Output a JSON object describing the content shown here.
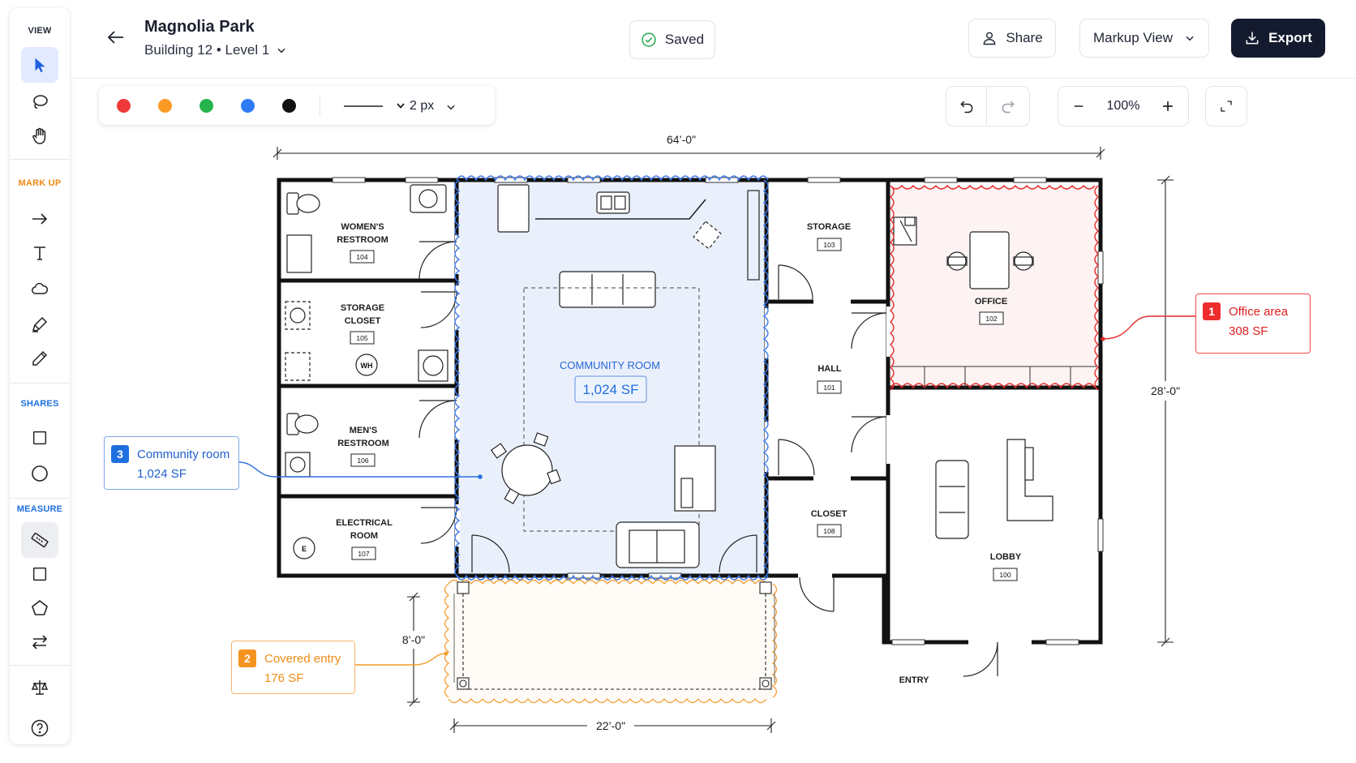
{
  "header": {
    "title": "Magnolia Park",
    "subtitle": "Building 12 • Level 1",
    "saved_label": "Saved",
    "share_label": "Share",
    "view_label": "Markup View",
    "export_label": "Export"
  },
  "rail": {
    "sections": {
      "view": "VIEW",
      "markup": "MARK UP",
      "shares": "SHARES",
      "measure": "MEASURE"
    }
  },
  "toolbar": {
    "colors": [
      "#f03a3a",
      "#fb9a25",
      "#25b44c",
      "#2f7bf5",
      "#111111"
    ],
    "stroke_width": "2 px",
    "zoom": "100%"
  },
  "colors": {
    "accent_blue": "#1f6fe0",
    "accent_red": "#ee2c2c",
    "accent_orange": "#f5931f",
    "dark": "#141b2e"
  },
  "plan": {
    "dimensions": {
      "overall_width": "64’-0\"",
      "overall_depth": "28’-0\"",
      "entry_depth": "8’-0\"",
      "entry_width": "22’-0\""
    },
    "rooms": [
      {
        "name": "WOMEN'S",
        "name2": "RESTROOM",
        "number": "104"
      },
      {
        "name": "STORAGE",
        "name2": "CLOSET",
        "number": "105"
      },
      {
        "name": "MEN'S",
        "name2": "RESTROOM",
        "number": "106"
      },
      {
        "name": "ELECTRICAL",
        "name2": "ROOM",
        "number": "107"
      },
      {
        "name": "STORAGE",
        "name2": "",
        "number": "103"
      },
      {
        "name": "OFFICE",
        "name2": "",
        "number": "102"
      },
      {
        "name": "HALL",
        "name2": "",
        "number": "101"
      },
      {
        "name": "CLOSET",
        "name2": "",
        "number": "108"
      },
      {
        "name": "LOBBY",
        "name2": "",
        "number": "100"
      }
    ],
    "community_room": {
      "name": "COMMUNITY ROOM",
      "area": "1,024 SF"
    },
    "wh_label": "WH",
    "e_label": "E",
    "entry_label": "ENTRY"
  },
  "callouts": [
    {
      "number": "1",
      "title": "Office area",
      "area": "308 SF"
    },
    {
      "number": "2",
      "title": "Covered entry",
      "area": "176 SF"
    },
    {
      "number": "3",
      "title": "Community room",
      "area": "1,024 SF"
    }
  ]
}
